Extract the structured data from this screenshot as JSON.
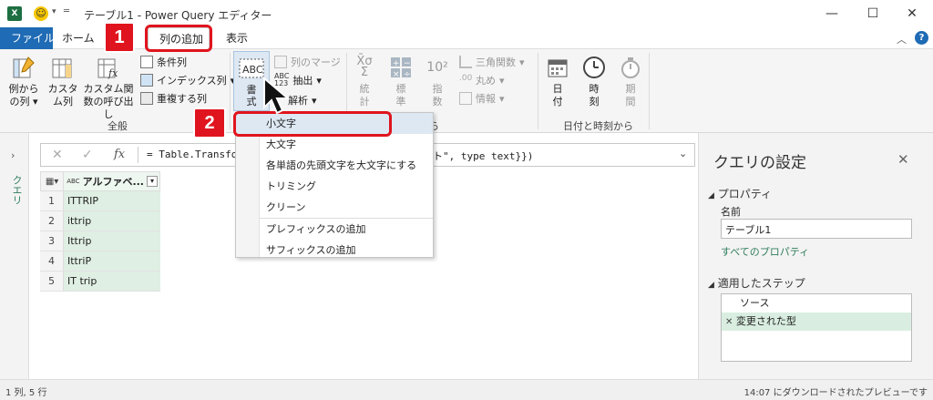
{
  "titlebar": {
    "title": "テーブル1 - Power Query エディター",
    "excel_icon": "excel-icon",
    "smiley_icon": "smiley-icon"
  },
  "tabs": [
    {
      "label": "ファイル"
    },
    {
      "label": "ホーム"
    },
    {
      "label": "列の追加"
    },
    {
      "label": "表示"
    }
  ],
  "ribbon": {
    "example_column": "例からの列",
    "custom_column": "カスタム列",
    "invoke_function": "カスタム関数の呼び出し",
    "conditional_column": "条件列",
    "index_column": "インデックス列",
    "duplicate_column": "重複する列",
    "group_general": "全般",
    "format": "書式",
    "merge_columns": "列のマージ",
    "extract": "抽出",
    "parse": "解析",
    "group_text_tail": "値から",
    "statistics": "統計",
    "standard": "標準",
    "scientific": "指数",
    "trigonometry": "三角関数",
    "rounding": "丸め",
    "information": "情報",
    "date": "日付",
    "time": "時刻",
    "duration": "期間",
    "group_datetime": "日付と時刻から"
  },
  "formula": {
    "fx": "fx",
    "text_left": "= Table.Transfo",
    "text_right": "ト\", type text}})"
  },
  "left_pane": {
    "label": "クエリ"
  },
  "grid": {
    "column_header": "アルファベ...",
    "type_icon": "ABC",
    "rows": [
      {
        "index": "1",
        "value": "ITTRIP"
      },
      {
        "index": "2",
        "value": "ittrip"
      },
      {
        "index": "3",
        "value": "Ittrip"
      },
      {
        "index": "4",
        "value": "IttriP"
      },
      {
        "index": "5",
        "value": "IT trip"
      }
    ]
  },
  "format_menu": {
    "items": [
      "小文字",
      "大文字",
      "各単語の先頭文字を大文字にする",
      "トリミング",
      "クリーン",
      "プレフィックスの追加",
      "サフィックスの追加"
    ]
  },
  "right_pane": {
    "title": "クエリの設定",
    "properties_header": "プロパティ",
    "name_label": "名前",
    "name_value": "テーブル1",
    "all_properties_link": "すべてのプロパティ",
    "steps_header": "適用したステップ",
    "steps": [
      "ソース",
      "変更された型"
    ]
  },
  "status": {
    "left": "1 列, 5 行",
    "right": "14:07 にダウンロードされたプレビューです"
  },
  "callouts": {
    "step1": "1",
    "step2": "2"
  },
  "colors": {
    "file_tab": "#1f6bb5",
    "accent_red": "#e0141e",
    "link_green": "#2e7d5b",
    "row_green": "#dfefe3"
  }
}
